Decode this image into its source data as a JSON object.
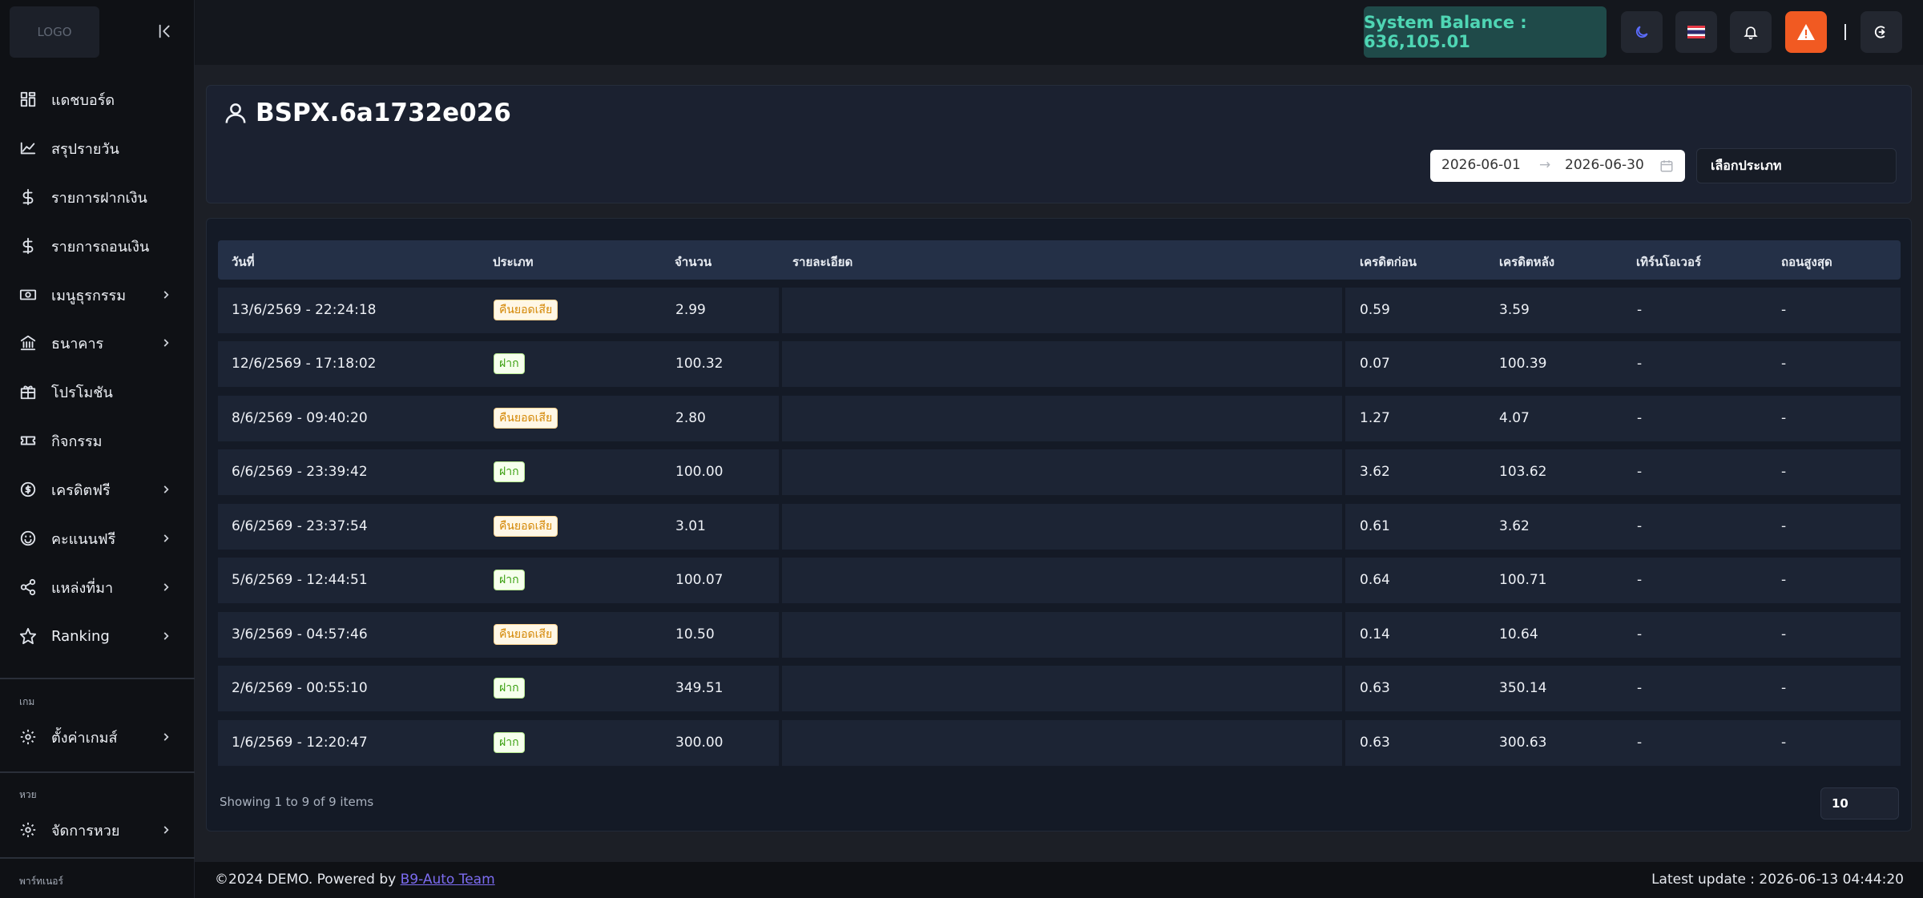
{
  "sidebar": {
    "logo": "LOGO",
    "items": [
      {
        "label": "แดชบอร์ด",
        "icon": "dashboard-icon",
        "chevron": false
      },
      {
        "label": "สรุปรายวัน",
        "icon": "chart-area-icon",
        "chevron": false
      },
      {
        "label": "รายการฝากเงิน",
        "icon": "dollar-icon",
        "chevron": false
      },
      {
        "label": "รายการถอนเงิน",
        "icon": "dollar-icon",
        "chevron": false
      },
      {
        "label": "เมนูธุรกรรม",
        "icon": "money-icon",
        "chevron": true
      },
      {
        "label": "ธนาคาร",
        "icon": "bank-icon",
        "chevron": true
      },
      {
        "label": "โปรโมชัน",
        "icon": "gift-icon",
        "chevron": false
      },
      {
        "label": "กิจกรรม",
        "icon": "ticket-icon",
        "chevron": false
      },
      {
        "label": "เครดิตฟรี",
        "icon": "coin-icon",
        "chevron": true
      },
      {
        "label": "คะแนนฟรี",
        "icon": "smile-icon",
        "chevron": true
      },
      {
        "label": "แหล่งที่มา",
        "icon": "share-icon",
        "chevron": true
      },
      {
        "label": "Ranking",
        "icon": "star-icon",
        "chevron": true
      }
    ],
    "section_game": "เกม",
    "game_item": {
      "label": "ตั้งค่าเกมส์",
      "icon": "gear-icon"
    },
    "section_lotto": "หวย",
    "lotto_item": {
      "label": "จัดการหวย",
      "icon": "gear-icon"
    },
    "section_partner": "พาร์ทเนอร์"
  },
  "topbar": {
    "balance": "System Balance : 636,105.01",
    "buttons": [
      "moon-icon",
      "thai-flag-icon",
      "bell-icon",
      "warning-icon",
      "logout-icon"
    ]
  },
  "header": {
    "username": "BSPX.6a1732e026",
    "date_from": "2026-06-01",
    "date_to": "2026-06-30",
    "type_placeholder": "เลือกประเภท"
  },
  "table": {
    "columns": [
      "วันที่",
      "ประเภท",
      "จำนวน",
      "รายละเอียด",
      "เครดิตก่อน",
      "เครดิตหลัง",
      "เทิร์นโอเวอร์",
      "ถอนสูงสุด"
    ],
    "rows": [
      {
        "date": "13/6/2569 - 22:24:18",
        "type": "คืนยอดเสีย",
        "kind": "refund",
        "amount": "2.99",
        "detail": "",
        "before": "0.59",
        "after": "3.59",
        "turnover": "-",
        "max_withdraw": "-"
      },
      {
        "date": "12/6/2569 - 17:18:02",
        "type": "ฝาก",
        "kind": "deposit",
        "amount": "100.32",
        "detail": "",
        "before": "0.07",
        "after": "100.39",
        "turnover": "-",
        "max_withdraw": "-"
      },
      {
        "date": "8/6/2569 - 09:40:20",
        "type": "คืนยอดเสีย",
        "kind": "refund",
        "amount": "2.80",
        "detail": "",
        "before": "1.27",
        "after": "4.07",
        "turnover": "-",
        "max_withdraw": "-"
      },
      {
        "date": "6/6/2569 - 23:39:42",
        "type": "ฝาก",
        "kind": "deposit",
        "amount": "100.00",
        "detail": "",
        "before": "3.62",
        "after": "103.62",
        "turnover": "-",
        "max_withdraw": "-"
      },
      {
        "date": "6/6/2569 - 23:37:54",
        "type": "คืนยอดเสีย",
        "kind": "refund",
        "amount": "3.01",
        "detail": "",
        "before": "0.61",
        "after": "3.62",
        "turnover": "-",
        "max_withdraw": "-"
      },
      {
        "date": "5/6/2569 - 12:44:51",
        "type": "ฝาก",
        "kind": "deposit",
        "amount": "100.07",
        "detail": "",
        "before": "0.64",
        "after": "100.71",
        "turnover": "-",
        "max_withdraw": "-"
      },
      {
        "date": "3/6/2569 - 04:57:46",
        "type": "คืนยอดเสีย",
        "kind": "refund",
        "amount": "10.50",
        "detail": "",
        "before": "0.14",
        "after": "10.64",
        "turnover": "-",
        "max_withdraw": "-"
      },
      {
        "date": "2/6/2569 - 00:55:10",
        "type": "ฝาก",
        "kind": "deposit",
        "amount": "349.51",
        "detail": "",
        "before": "0.63",
        "after": "350.14",
        "turnover": "-",
        "max_withdraw": "-"
      },
      {
        "date": "1/6/2569 - 12:20:47",
        "type": "ฝาก",
        "kind": "deposit",
        "amount": "300.00",
        "detail": "",
        "before": "0.63",
        "after": "300.63",
        "turnover": "-",
        "max_withdraw": "-"
      }
    ],
    "showing": "Showing 1 to 9 of 9 items",
    "page_size": "10"
  },
  "footer": {
    "copyright": "©2024 DEMO. Powered by ",
    "link": "B9-Auto Team",
    "latest_update": "Latest update : 2026-06-13 04:44:20"
  },
  "colors": {
    "balance_text": "#4fd6b4",
    "alert": "#f15a22",
    "refund_badge": "#d48806",
    "deposit_badge": "#389e0d",
    "link": "#7c6cf0"
  }
}
